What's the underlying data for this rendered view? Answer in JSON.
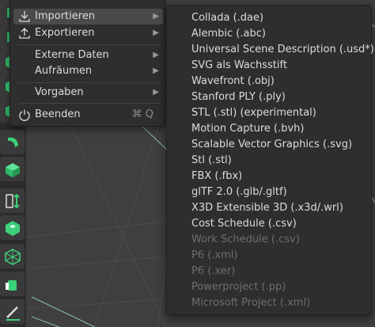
{
  "file_menu": {
    "items": [
      {
        "label": "Importieren",
        "icon": "import-icon",
        "has_submenu": true,
        "active": true
      },
      {
        "label": "Exportieren",
        "icon": "export-icon",
        "has_submenu": true
      },
      {
        "label": "Externe Daten",
        "has_submenu": true
      },
      {
        "label": "Aufräumen",
        "has_submenu": true
      },
      {
        "label": "Vorgaben",
        "has_submenu": true
      },
      {
        "label": "Beenden",
        "icon": "power-icon",
        "shortcut": "⌘ Q"
      }
    ],
    "submenu_arrow": "▶"
  },
  "import_submenu": {
    "items": [
      {
        "label": "Collada (.dae)",
        "enabled": true
      },
      {
        "label": "Alembic (.abc)",
        "enabled": true
      },
      {
        "label": "Universal Scene Description (.usd*)",
        "enabled": true
      },
      {
        "label": "SVG als Wachsstift",
        "enabled": true
      },
      {
        "label": "Wavefront (.obj)",
        "enabled": true
      },
      {
        "label": "Stanford PLY (.ply)",
        "enabled": true
      },
      {
        "label": "STL (.stl) (experimental)",
        "enabled": true
      },
      {
        "label": "Motion Capture (.bvh)",
        "enabled": true
      },
      {
        "label": "Scalable Vector Graphics (.svg)",
        "enabled": true
      },
      {
        "label": "Stl (.stl)",
        "enabled": true
      },
      {
        "label": "FBX (.fbx)",
        "enabled": true
      },
      {
        "label": "glTF 2.0 (.glb/.gltf)",
        "enabled": true
      },
      {
        "label": "X3D Extensible 3D (.x3d/.wrl)",
        "enabled": true
      },
      {
        "label": "Cost Schedule (.csv)",
        "enabled": true
      },
      {
        "label": "Work Schedule (.csv)",
        "enabled": false
      },
      {
        "label": "P6 (.xml)",
        "enabled": false
      },
      {
        "label": "P6 (.xer)",
        "enabled": false
      },
      {
        "label": "Powerproject (.pp)",
        "enabled": false
      },
      {
        "label": "Microsoft Project (.xml)",
        "enabled": false
      }
    ]
  },
  "toolbar": {
    "tools": [
      {
        "icon": "cube-icon"
      },
      {
        "icon": "cube-icon"
      },
      {
        "icon": "cube-icon"
      },
      {
        "icon": "torus-icon"
      },
      {
        "icon": "cube-icon"
      },
      {
        "icon": "measure-icon"
      },
      {
        "icon": "solid-icon"
      },
      {
        "icon": "wireframe-icon"
      },
      {
        "icon": "shape-icon"
      },
      {
        "icon": "pencil-icon"
      }
    ]
  },
  "colors": {
    "accent_green": "#3dd17a",
    "menu_bg": "#2e2e2e",
    "text": "#dcdcdc",
    "disabled_text": "#6e6e6e"
  }
}
